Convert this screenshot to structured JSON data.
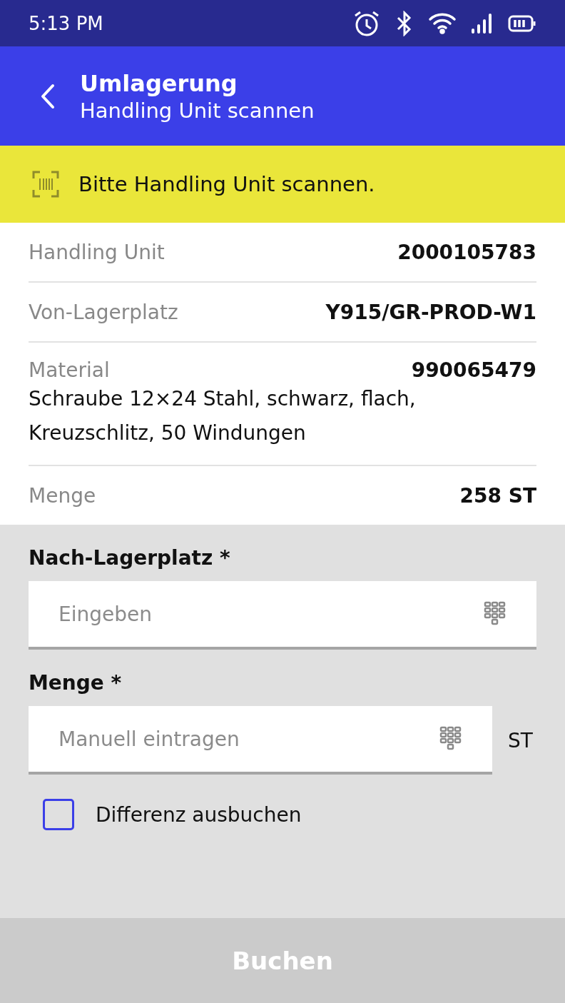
{
  "status_bar": {
    "time": "5:13 PM"
  },
  "app_bar": {
    "title": "Umlagerung",
    "subtitle": "Handling Unit scannen"
  },
  "banner": {
    "text": "Bitte Handling Unit scannen."
  },
  "details": [
    {
      "label": "Handling Unit",
      "value": "2000105783"
    },
    {
      "label": "Von-Lagerplatz",
      "value": "Y915/GR-PROD-W1"
    },
    {
      "label": "Material",
      "value": "990065479",
      "description": "Schraube 12×24 Stahl, schwarz, flach, Kreuzschlitz, 50 Windungen"
    },
    {
      "label": "Menge",
      "value": "258 ST"
    }
  ],
  "fields": [
    {
      "label": "Nach-Lagerplatz *",
      "placeholder": "Eingeben"
    },
    {
      "label": "Menge *",
      "placeholder": "Manuell eintragen",
      "unit": "ST"
    }
  ],
  "checkbox": {
    "label": "Differenz ausbuchen",
    "checked": false
  },
  "submit": {
    "label": "Buchen",
    "disabled": true
  }
}
